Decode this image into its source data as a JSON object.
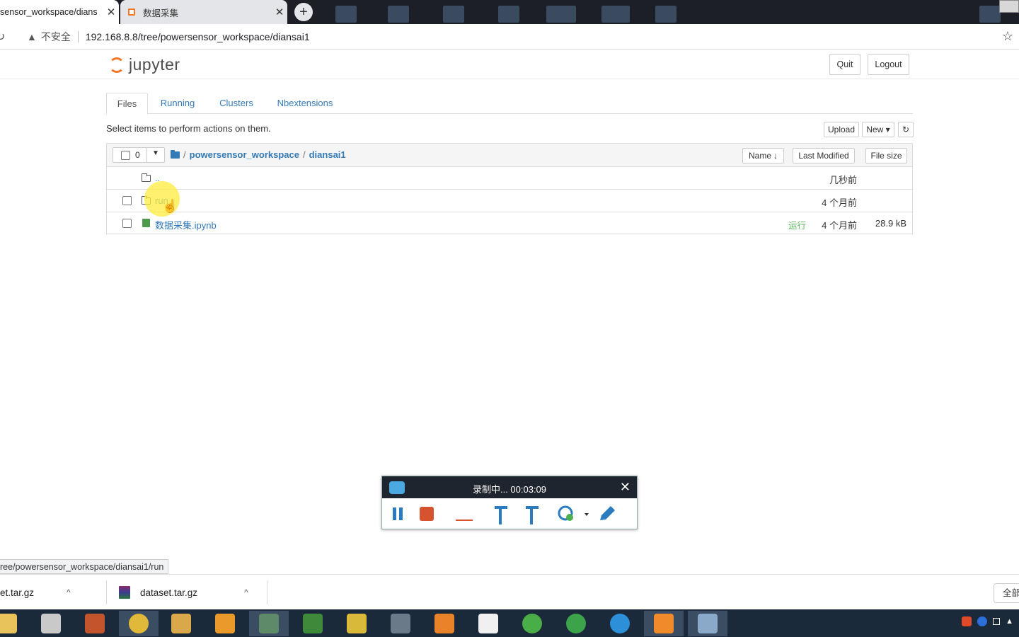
{
  "browser": {
    "active_tab_title": "sensor_workspace/dians",
    "inactive_tab_title": "数据采集",
    "new_tab_label": "+",
    "close_label": "✕",
    "security_label": "不安全",
    "url": "192.168.8.8/tree/powersensor_workspace/diansai1",
    "status_url": "ree/powersensor_workspace/diansai1/run"
  },
  "header": {
    "logo_text": "jupyter",
    "quit_label": "Quit",
    "logout_label": "Logout"
  },
  "tabs": [
    "Files",
    "Running",
    "Clusters",
    "Nbextensions"
  ],
  "toolbar": {
    "hint": "Select items to perform actions on them.",
    "upload_label": "Upload",
    "new_label": "New ▾",
    "refresh_icon": "refresh-icon"
  },
  "list": {
    "selected_count": "0",
    "crumb_sep": "/",
    "breadcrumb": [
      "powersensor_workspace",
      "diansai1"
    ],
    "columns": {
      "name": "Name",
      "last_modified": "Last Modified",
      "file_size": "File size"
    },
    "rows": [
      {
        "name": "..",
        "modified": "几秒前",
        "size": "",
        "status": "",
        "kind": "parent"
      },
      {
        "name": "run",
        "modified": "4 个月前",
        "size": "",
        "status": "",
        "kind": "folder"
      },
      {
        "name": "数据采集.ipynb",
        "modified": "4 个月前",
        "size": "28.9 kB",
        "status": "运行",
        "kind": "notebook"
      }
    ]
  },
  "recorder": {
    "title": "录制中... 00:03:09",
    "close_label": "✕"
  },
  "downloads": [
    {
      "name": "et.tar.gz",
      "chevron": "^"
    },
    {
      "name": "dataset.tar.gz",
      "chevron": "^"
    }
  ],
  "downloads_show_all": "全部",
  "colors": {
    "link": "#337ab7",
    "orange": "#f37726",
    "tabbar": "#1c1f25",
    "taskbar": "#1b2a3a",
    "record_red": "#d5532f",
    "record_blue": "#2b7bc0"
  }
}
